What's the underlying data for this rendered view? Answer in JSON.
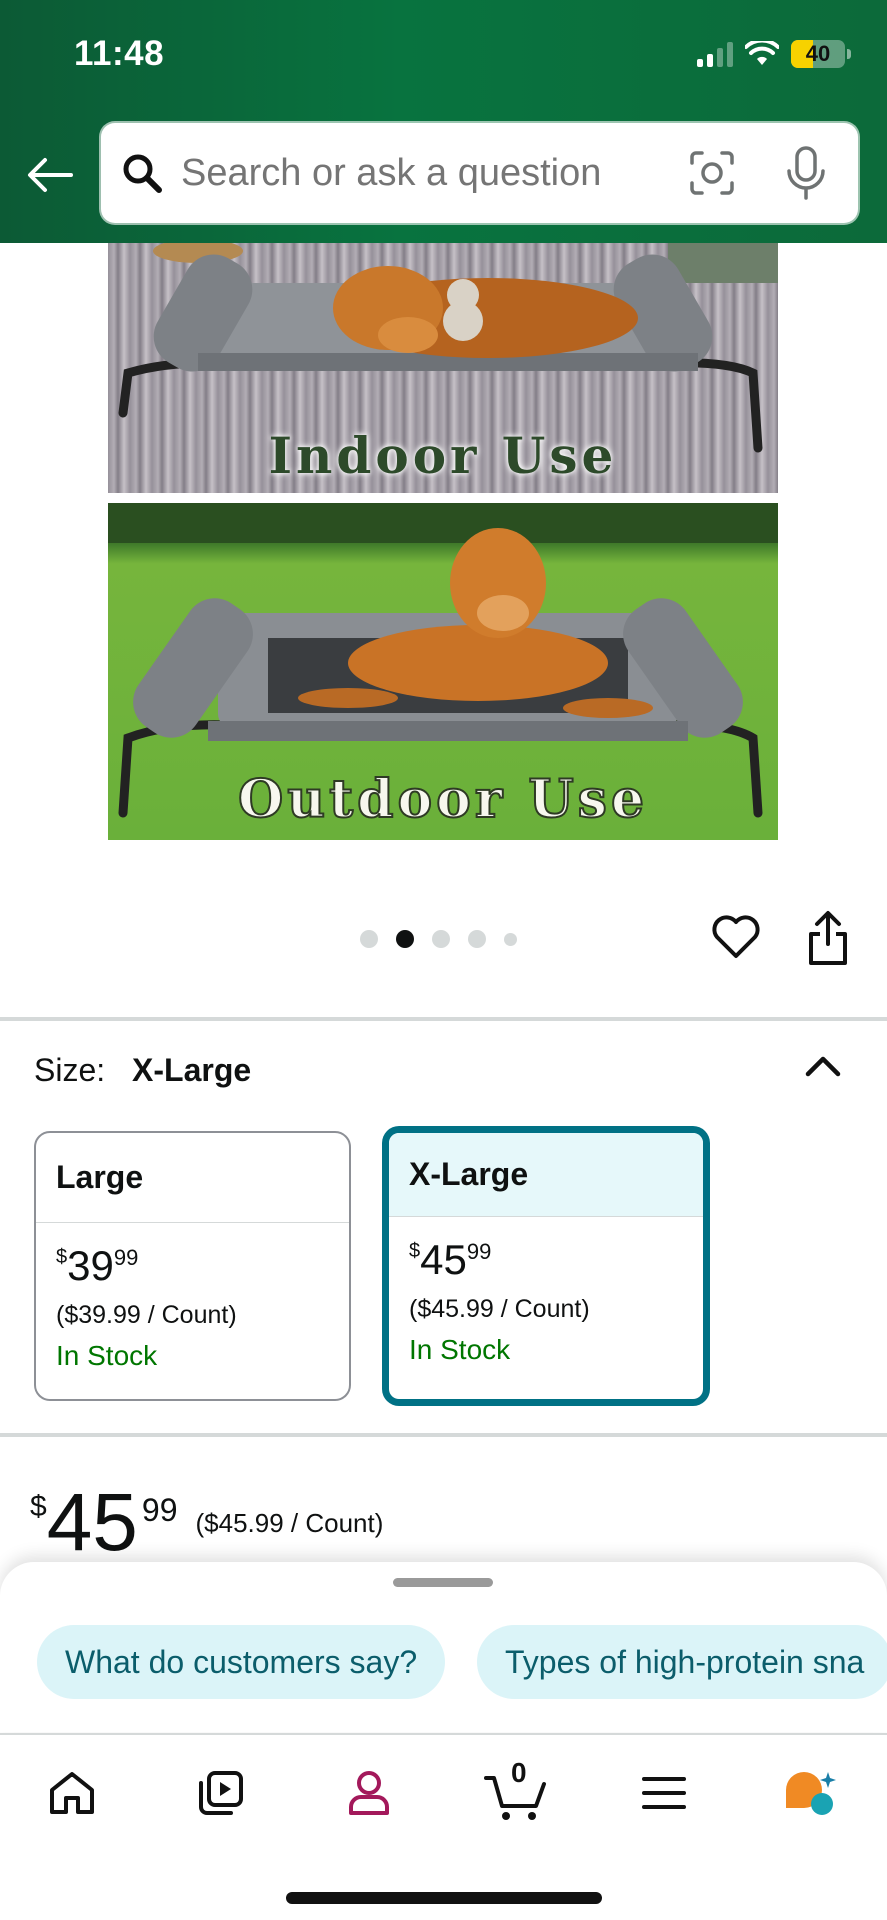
{
  "status_bar": {
    "time": "11:48",
    "battery": "40"
  },
  "search": {
    "placeholder": "Search or ask a question"
  },
  "product": {
    "images": {
      "caption_indoor": "Indoor Use",
      "caption_outdoor": "Outdoor Use"
    },
    "carousel": {
      "total": 5,
      "active_index": 1
    }
  },
  "size": {
    "label": "Size:",
    "selected": "X-Large",
    "options": [
      {
        "name": "Large",
        "currency": "$",
        "whole": "39",
        "cents": "99",
        "unit_price": "($39.99 / Count)",
        "stock": "In Stock",
        "selected": false
      },
      {
        "name": "X-Large",
        "currency": "$",
        "whole": "45",
        "cents": "99",
        "unit_price": "($45.99 / Count)",
        "stock": "In Stock",
        "selected": true
      }
    ]
  },
  "price": {
    "currency": "$",
    "whole": "45",
    "cents": "99",
    "unit_price": "($45.99 / Count)"
  },
  "suggestions": [
    "What do customers say?",
    "Types of high-protein sna"
  ],
  "tabbar": {
    "items": [
      "home-icon",
      "video-icon",
      "account-icon",
      "cart-icon",
      "menu-icon",
      "rufus-icon"
    ],
    "cart_count": "0",
    "accent_color": "#a3195b"
  },
  "colors": {
    "header_start": "#0c5a35",
    "header_end": "#08733f",
    "link": "#007185",
    "in_stock": "#007600",
    "chip_bg": "#dbf4f8"
  }
}
